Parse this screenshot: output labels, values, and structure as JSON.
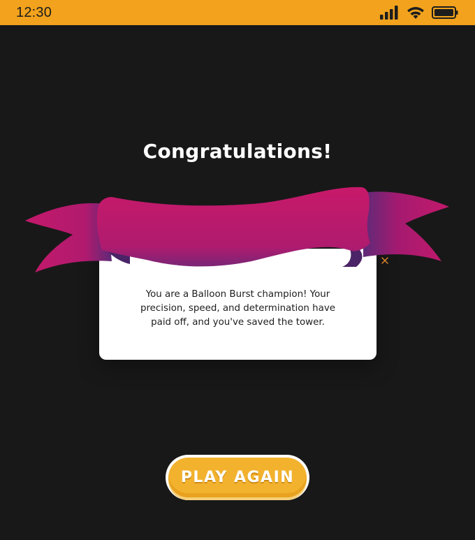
{
  "status_bar": {
    "time": "12:30",
    "icons": [
      "signal-icon",
      "wifi-icon",
      "battery-icon"
    ],
    "background": "#F2A21C"
  },
  "dialog": {
    "title": "Congratulations!",
    "message": "You are a Balloon Burst champion! Your precision, speed, and determination have paid off, and you've saved the tower.",
    "close_icon": "close-icon",
    "ribbon_colors": [
      "#C4196B",
      "#6A2A7A"
    ]
  },
  "actions": {
    "play_again_label": "PLAY AGAIN",
    "button_color": "#F2B22E"
  },
  "theme": {
    "background": "#181818"
  }
}
